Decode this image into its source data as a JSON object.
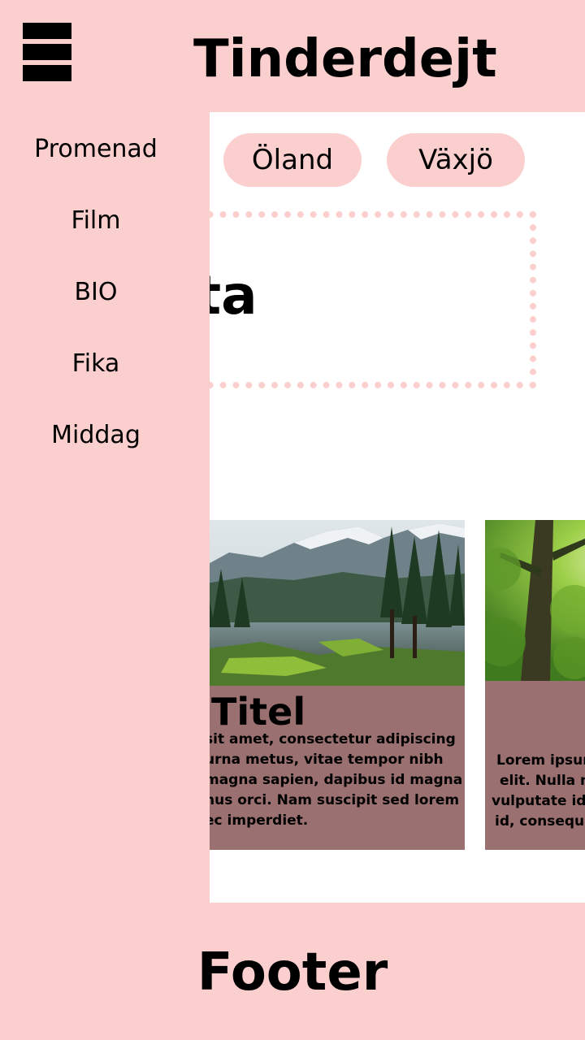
{
  "header": {
    "title": "Tinderdejt",
    "menu_icon": "hamburger-menu-icon"
  },
  "sidebar": {
    "items": [
      {
        "label": "Promenad"
      },
      {
        "label": "Film"
      },
      {
        "label": "BIO"
      },
      {
        "label": "Fika"
      },
      {
        "label": "Middag"
      }
    ]
  },
  "main": {
    "chips": [
      {
        "label": "Öland"
      },
      {
        "label": "Växjö"
      }
    ],
    "info_text": "nforuta",
    "cards": [
      {
        "title": "Titel",
        "body_lines": [
          "sit amet, consectetur adipiscing",
          "urna metus, vitae tempor nibh",
          "magna sapien, dapibus id magna",
          "nus orci. Nam suscipit sed lorem",
          "ec imperdiet."
        ],
        "image": "mountain-lake-landscape"
      },
      {
        "title": "",
        "body_lines": [
          "Lorem ipsum",
          "elit. Nulla m",
          "vulputate id.",
          "id, consequa"
        ],
        "image": "forest-tree-landscape"
      }
    ]
  },
  "footer": {
    "text": "Footer"
  },
  "colors": {
    "pink": "#fccfcf",
    "card": "#9b7070",
    "white": "#ffffff",
    "black": "#000000"
  }
}
